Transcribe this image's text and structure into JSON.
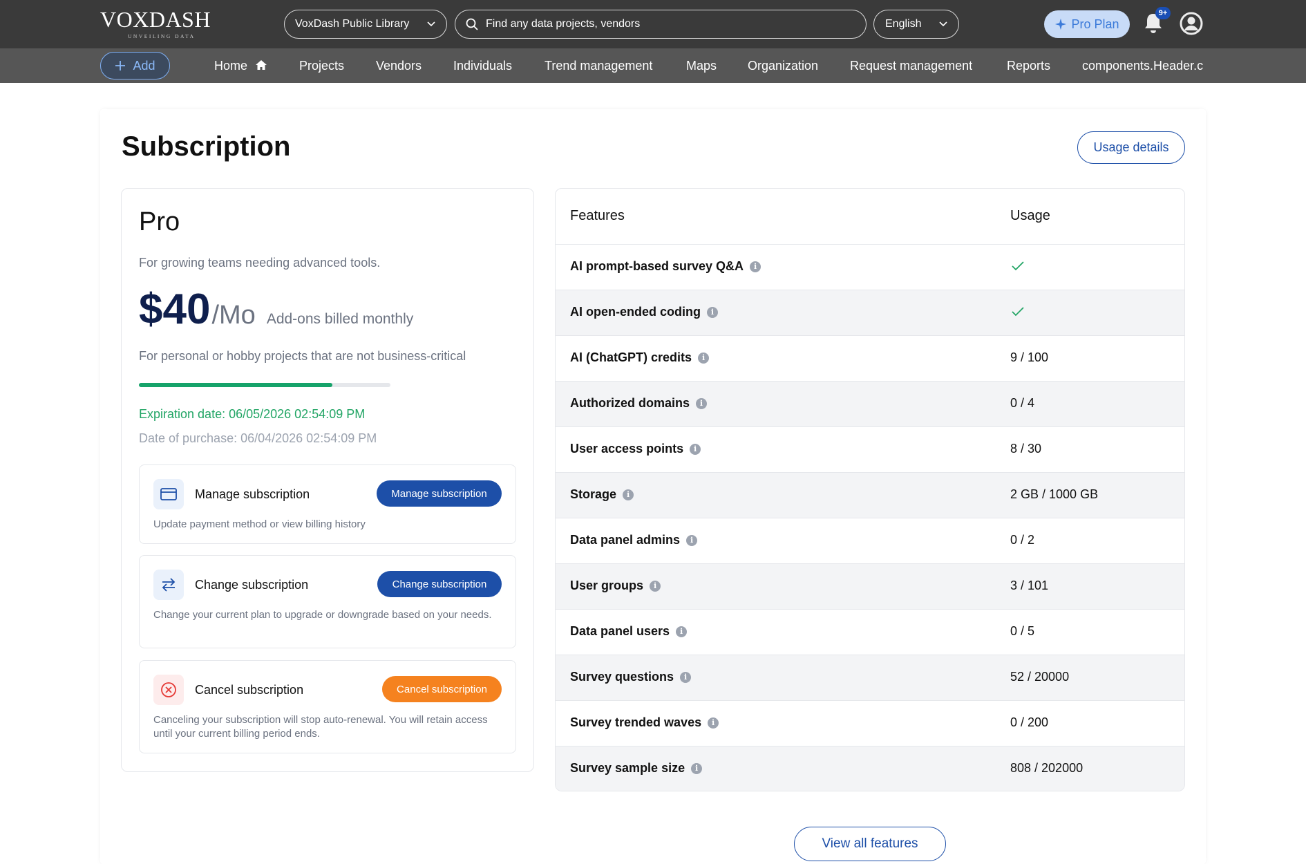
{
  "header": {
    "logo_text": "VOXDASH",
    "logo_tagline": "UNVEILING DATA",
    "library_select": "VoxDash Public Library",
    "search_placeholder": "Find any data projects, vendors",
    "language_select": "English",
    "pro_plan_label": "Pro Plan",
    "notification_badge": "9+"
  },
  "nav": {
    "add_label": "Add",
    "items": [
      "Home",
      "Projects",
      "Vendors",
      "Individuals",
      "Trend management",
      "Maps",
      "Organization",
      "Request management",
      "Reports",
      "components.Header.c"
    ]
  },
  "page": {
    "title": "Subscription",
    "usage_details_label": "Usage details",
    "view_all_label": "View all features"
  },
  "plan": {
    "name": "Pro",
    "description": "For growing teams needing advanced tools.",
    "price": "$40",
    "period": "/Mo",
    "price_note": "Add-ons billed monthly",
    "note": "For personal or hobby projects that are not business-critical",
    "progress_fraction": 0.77,
    "expiration": "Expiration date: 06/05/2026 02:54:09 PM",
    "purchase": "Date of purchase: 06/04/2026 02:54:09 PM"
  },
  "actions": [
    {
      "title": "Manage subscription",
      "button": "Manage subscription",
      "description": "Update payment method or view billing history",
      "icon": "credit-card-icon",
      "color": "#1d4fa8"
    },
    {
      "title": "Change subscription",
      "button": "Change subscription",
      "description": "Change your current plan to upgrade or downgrade based on your needs.",
      "icon": "swap-arrows-icon",
      "color": "#1d4fa8"
    },
    {
      "title": "Cancel subscription",
      "button": "Cancel subscription",
      "description": "Canceling your subscription will stop auto-renewal. You will retain access until your current billing period ends.",
      "icon": "cancel-circle-icon",
      "color": "#f5821f"
    }
  ],
  "features": {
    "col_feature": "Features",
    "col_usage": "Usage",
    "rows": [
      {
        "name": "AI prompt-based survey Q&A",
        "usage": "check"
      },
      {
        "name": "AI open-ended coding",
        "usage": "check"
      },
      {
        "name": "AI (ChatGPT) credits",
        "usage": "9 / 100"
      },
      {
        "name": "Authorized domains",
        "usage": "0 / 4"
      },
      {
        "name": "User access points",
        "usage": "8 / 30"
      },
      {
        "name": "Storage",
        "usage": "2 GB / 1000 GB"
      },
      {
        "name": "Data panel admins",
        "usage": "0 / 2"
      },
      {
        "name": "User groups",
        "usage": "3 / 101"
      },
      {
        "name": "Data panel users",
        "usage": "0 / 5"
      },
      {
        "name": "Survey questions",
        "usage": "52 / 20000"
      },
      {
        "name": "Survey trended waves",
        "usage": "0 / 200"
      },
      {
        "name": "Survey sample size",
        "usage": "808 / 202000"
      }
    ]
  },
  "colors": {
    "topbar": "#3a3a3a",
    "navbar": "#565656",
    "primary": "#1d4fa8",
    "success": "#22a565",
    "warning": "#f5821f"
  }
}
